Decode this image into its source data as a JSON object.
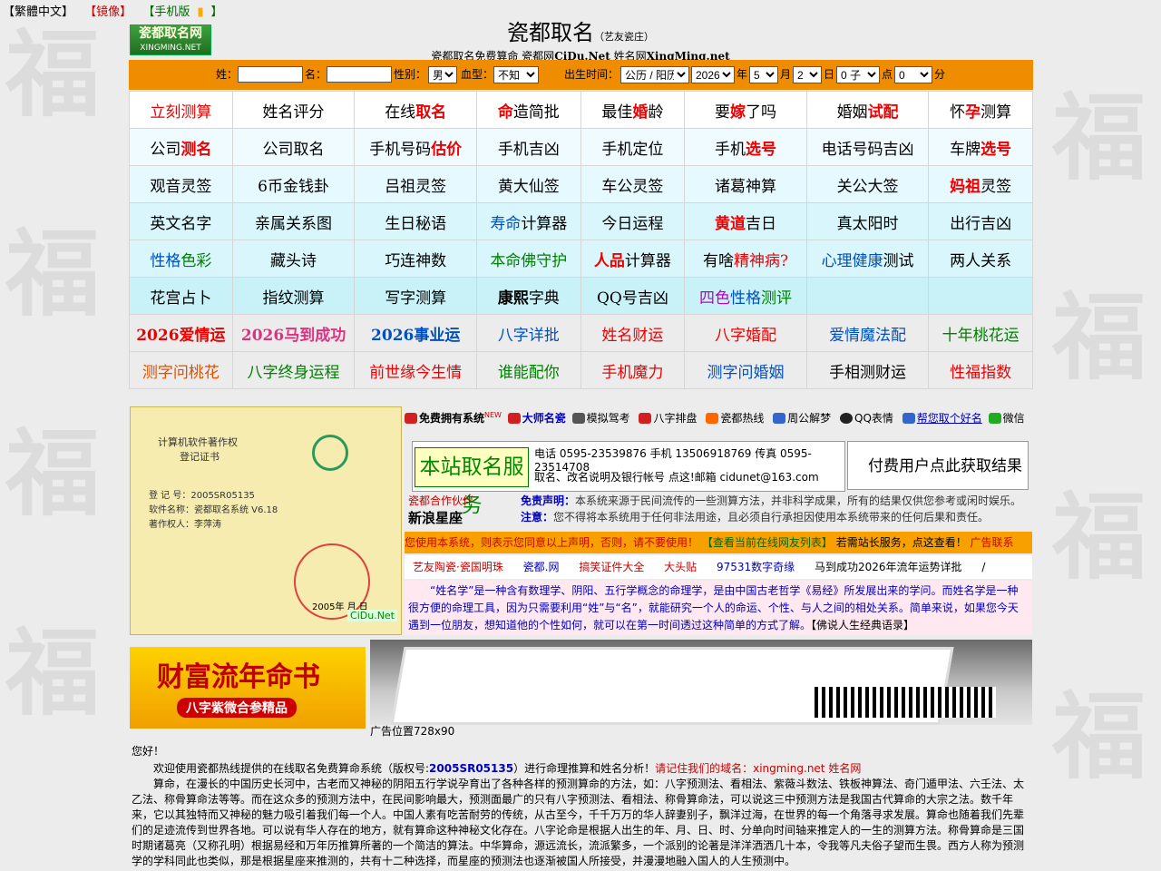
{
  "top_links": [
    "【繁體中文】",
    "【镜像】",
    "【手机版",
    "】"
  ],
  "logo": {
    "cn": "瓷都取名网",
    "en": "XINGMING.NET"
  },
  "header": {
    "title": "瓷都取名",
    "title_note": "（艺友瓷庄）",
    "subtitle_a": "瓷都取名免费算命 瓷都网",
    "subtitle_b": "CiDu.Net",
    "subtitle_c": " 姓名网",
    "subtitle_d": "XingMing.net"
  },
  "form": {
    "surname_label": "姓：",
    "name_label": "名：",
    "gender_label": "性别：",
    "gender_value": "男",
    "blood_label": "血型：",
    "blood_value": "不知",
    "birth_label": "出生时间：",
    "calendar_value": "公历 / 阳历",
    "year_value": "2026",
    "year_label": "年",
    "month_value": "5",
    "month_label": "月",
    "day_value": "2",
    "day_label": "日",
    "hour_value": "0 子",
    "hour_label": "点",
    "minute_value": "0",
    "minute_label": "分"
  },
  "grid": [
    [
      {
        "p": [
          [
            "立刻测算",
            "redw"
          ]
        ]
      },
      {
        "p": [
          [
            "姓名评分",
            ""
          ]
        ]
      },
      {
        "p": [
          [
            "在线",
            ""
          ],
          [
            "取名",
            "redb"
          ]
        ]
      },
      {
        "p": [
          [
            "命",
            "redb"
          ],
          [
            "造简批",
            ""
          ]
        ]
      },
      {
        "p": [
          [
            "最佳",
            ""
          ],
          [
            "婚",
            "redb"
          ],
          [
            "龄",
            ""
          ]
        ]
      },
      {
        "p": [
          [
            "要",
            ""
          ],
          [
            "嫁",
            "redb"
          ],
          [
            "了吗",
            ""
          ]
        ]
      },
      {
        "p": [
          [
            "婚姻",
            ""
          ],
          [
            "试配",
            "redb"
          ]
        ]
      },
      {
        "p": [
          [
            "怀",
            ""
          ],
          [
            "孕",
            "redb"
          ],
          [
            "测算",
            ""
          ]
        ]
      }
    ],
    [
      {
        "p": [
          [
            "公司",
            ""
          ],
          [
            "测名",
            "redb"
          ]
        ]
      },
      {
        "p": [
          [
            "公司取名",
            ""
          ]
        ]
      },
      {
        "p": [
          [
            "手机号码",
            ""
          ],
          [
            "估价",
            "redb"
          ]
        ]
      },
      {
        "p": [
          [
            "手机吉凶",
            ""
          ]
        ]
      },
      {
        "p": [
          [
            "手机定位",
            ""
          ]
        ]
      },
      {
        "p": [
          [
            "手机",
            ""
          ],
          [
            "选号",
            "redb"
          ]
        ]
      },
      {
        "p": [
          [
            "电话号码吉凶",
            ""
          ]
        ]
      },
      {
        "p": [
          [
            "车牌",
            ""
          ],
          [
            "选号",
            "redb"
          ]
        ]
      }
    ],
    [
      {
        "p": [
          [
            "观音灵签",
            ""
          ]
        ]
      },
      {
        "p": [
          [
            "6币金钱卦",
            ""
          ]
        ]
      },
      {
        "p": [
          [
            "吕祖灵签",
            ""
          ]
        ]
      },
      {
        "p": [
          [
            "黄大仙签",
            ""
          ]
        ]
      },
      {
        "p": [
          [
            "车公灵签",
            ""
          ]
        ]
      },
      {
        "p": [
          [
            "诸葛神算",
            ""
          ]
        ]
      },
      {
        "p": [
          [
            "关公大签",
            ""
          ]
        ]
      },
      {
        "p": [
          [
            "妈祖",
            "redb"
          ],
          [
            "灵签",
            ""
          ]
        ]
      }
    ],
    [
      {
        "p": [
          [
            "英文名字",
            ""
          ]
        ]
      },
      {
        "p": [
          [
            "亲属关系图",
            ""
          ]
        ]
      },
      {
        "p": [
          [
            "生日秘语",
            ""
          ]
        ]
      },
      {
        "p": [
          [
            "寿命",
            "blue"
          ],
          [
            "计算器",
            ""
          ]
        ]
      },
      {
        "p": [
          [
            "今日运程",
            ""
          ]
        ]
      },
      {
        "p": [
          [
            "黄道",
            "redb"
          ],
          [
            "吉日",
            ""
          ]
        ]
      },
      {
        "p": [
          [
            "真太阳时",
            ""
          ]
        ]
      },
      {
        "p": [
          [
            "出行吉凶",
            ""
          ]
        ]
      }
    ],
    [
      {
        "p": [
          [
            "性格",
            "blue"
          ],
          [
            "色彩",
            "grn2"
          ]
        ]
      },
      {
        "p": [
          [
            "藏头诗",
            ""
          ]
        ]
      },
      {
        "p": [
          [
            "巧连神数",
            ""
          ]
        ]
      },
      {
        "p": [
          [
            "本命佛守护",
            "grn2"
          ]
        ]
      },
      {
        "p": [
          [
            "人品",
            "redb"
          ],
          [
            "计算器",
            ""
          ]
        ]
      },
      {
        "p": [
          [
            "有啥",
            ""
          ],
          [
            "精神病?",
            "redw"
          ]
        ]
      },
      {
        "p": [
          [
            "心理健康",
            "blue"
          ],
          [
            "测试",
            ""
          ]
        ]
      },
      {
        "p": [
          [
            "两人关系",
            ""
          ]
        ]
      }
    ],
    [
      {
        "p": [
          [
            "花宫占卜",
            ""
          ]
        ]
      },
      {
        "p": [
          [
            "指纹测算",
            ""
          ]
        ]
      },
      {
        "p": [
          [
            "写字测算",
            ""
          ]
        ]
      },
      {
        "p": [
          [
            "康熙",
            "bk"
          ],
          [
            "字典",
            ""
          ]
        ]
      },
      {
        "p": [
          [
            "QQ号吉凶",
            ""
          ]
        ]
      },
      {
        "p": [
          [
            "四色",
            "purple"
          ],
          [
            "性格",
            "blue"
          ],
          [
            "测评",
            "grn2"
          ]
        ]
      },
      {
        "p": []
      },
      {
        "p": []
      }
    ],
    [
      {
        "p": [
          [
            "2026爱情运",
            "redb"
          ]
        ]
      },
      {
        "p": [
          [
            "2026马到成功",
            "pinkb"
          ]
        ]
      },
      {
        "p": [
          [
            "2026事业运",
            "blueb"
          ]
        ]
      },
      {
        "p": [
          [
            "八字详批",
            "blue"
          ]
        ]
      },
      {
        "p": [
          [
            "姓名财运",
            "redw"
          ]
        ]
      },
      {
        "p": [
          [
            "八字婚配",
            "redw"
          ]
        ]
      },
      {
        "p": [
          [
            "爱情魔法配",
            "blue"
          ]
        ]
      },
      {
        "p": [
          [
            "十年桃花运",
            "grn2"
          ]
        ]
      }
    ],
    [
      {
        "p": [
          [
            "测字问桃花",
            "orange"
          ]
        ]
      },
      {
        "p": [
          [
            "八字终身运程",
            "grn2"
          ]
        ]
      },
      {
        "p": [
          [
            "前世缘今生情",
            "redw"
          ]
        ]
      },
      {
        "p": [
          [
            "谁能配你",
            "grn2"
          ]
        ]
      },
      {
        "p": [
          [
            "手机魔力",
            "redw"
          ]
        ]
      },
      {
        "p": [
          [
            "测字问婚姻",
            "blue"
          ]
        ]
      },
      {
        "p": [
          [
            "手相测财运",
            ""
          ]
        ]
      },
      {
        "p": [
          [
            "性福指数",
            "redw"
          ]
        ]
      }
    ]
  ],
  "certificate": {
    "heading": "计算机软件著作权",
    "heading2": "登记证书",
    "lines": [
      "登 记 号：2005SR05135",
      "软件名称：瓷都取名系统 V6.18",
      "著作权人：李萍涛"
    ],
    "date": "2005年 月 日",
    "domain": "CiDu.Net"
  },
  "nav_links": [
    "免费拥有系统",
    "NEW",
    "大师名瓷",
    "模拟驾考",
    "八字排盘",
    "瓷都热线",
    "周公解梦",
    "QQ表情",
    "帮您取个好名",
    "微信"
  ],
  "service": {
    "big": "本站取名服务",
    "line1": "电话 0595-23539876 手机 13506918769 传真 0595-23514708",
    "line2": "取名、改名说明及银行帐号 点这!邮箱 cidunet@163.com",
    "pay": "付费用户点此获取结果"
  },
  "sina": {
    "partner": "瓷都合作伙伴",
    "name": "新浪星座"
  },
  "disclaimer": {
    "label1": "免责声明：",
    "text1": "本系统来源于民间流传的一些测算方法，并非科学成果，所有的结果仅供您参考或闲时娱乐。",
    "label2": "注意：",
    "text2": "您不得将本系统用于任何非法用途，且必须自行承担因使用本系统带来的任何后果和责任。"
  },
  "warning": {
    "red": "您使用本系统，则表示您同意以上声明，否则，请不要使用！",
    "green": "【查看当前在线网友列表】",
    "black": "若需站长服务，点这查看！",
    "ad": "广告联系"
  },
  "links_bar": [
    "艺友陶瓷·瓷国明珠",
    "瓷都.网",
    "搞笑证件大全",
    "大头贴",
    "97531数字奇缘",
    "马到成功2026年流年运势详批",
    "/"
  ],
  "intro": {
    "text": "“姓名学”是一种含有数理学、阴阳、五行学概念的命理学，是由中国古老哲学《易经》所发展出来的学问。而姓名学是一种很方便的命理工具，因为只需要利用“姓”与“名”，就能研究一个人的命运、个性、与人之间的相处关系。简单来说，如果您今天遇到一位朋友，想知道他的个性如何，就可以在第一时间透过这种简单的方式了解。",
    "link": "【佛说人生经典语录】"
  },
  "ad1": {
    "title": "财富流年命书",
    "sub": "八字紫微合参精品"
  },
  "ad2_label": "广告位置728x90",
  "body": {
    "greeting": "您好！",
    "p1a": "欢迎使用瓷都热线提供的在线取名免费算命系统（版权号:",
    "p1b": "2005SR05135",
    "p1c": "）进行命理推算和姓名分析！",
    "p1d": "请记住我们的域名：xingming.net 姓名网",
    "p2": "算命，在漫长的中国历史长河中，古老而又神秘的阴阳五行学说孕育出了各种各样的预测算命的方法，如：八字预测法、看相法、紫薇斗数法、铁板神算法、奇门遁甲法、六壬法、太乙法、称骨算命法等等。而在这众多的预测方法中，在民间影响最大，预测面最广的只有八字预测法、看相法、称骨算命法，可以说这三中预测方法是我国古代算命的大宗之法。数千年来，它以其独特而又神秘的魅力吸引着我们每一个人。中国人素有吃苦耐劳的传统，从古至今，千千万万的华人辞妻别子，飘洋过海，在世界的每一个角落寻求发展。算命也随着我们先辈们的足迹流传到世界各地。可以说有华人存在的地方，就有算命这种神秘文化存在。八字论命是根据人出生的年、月、日、时、分单向时间轴来推定人的一生的测算方法。称骨算命是三国时期诸葛亮（又称孔明）根据易经和万年历推算所著的一个简洁的算法。中华算命，源远流长，流派繁多，一个派别的论著是洋洋洒洒几十本，令我等凡夫俗子望而生畏。西方人称为预测学的学科同此也类似，那是根据星座来推测的，共有十二种选择，而星座的预测法也逐渐被国人所接受，并漫漫地融入国人的人生预测中。"
  }
}
